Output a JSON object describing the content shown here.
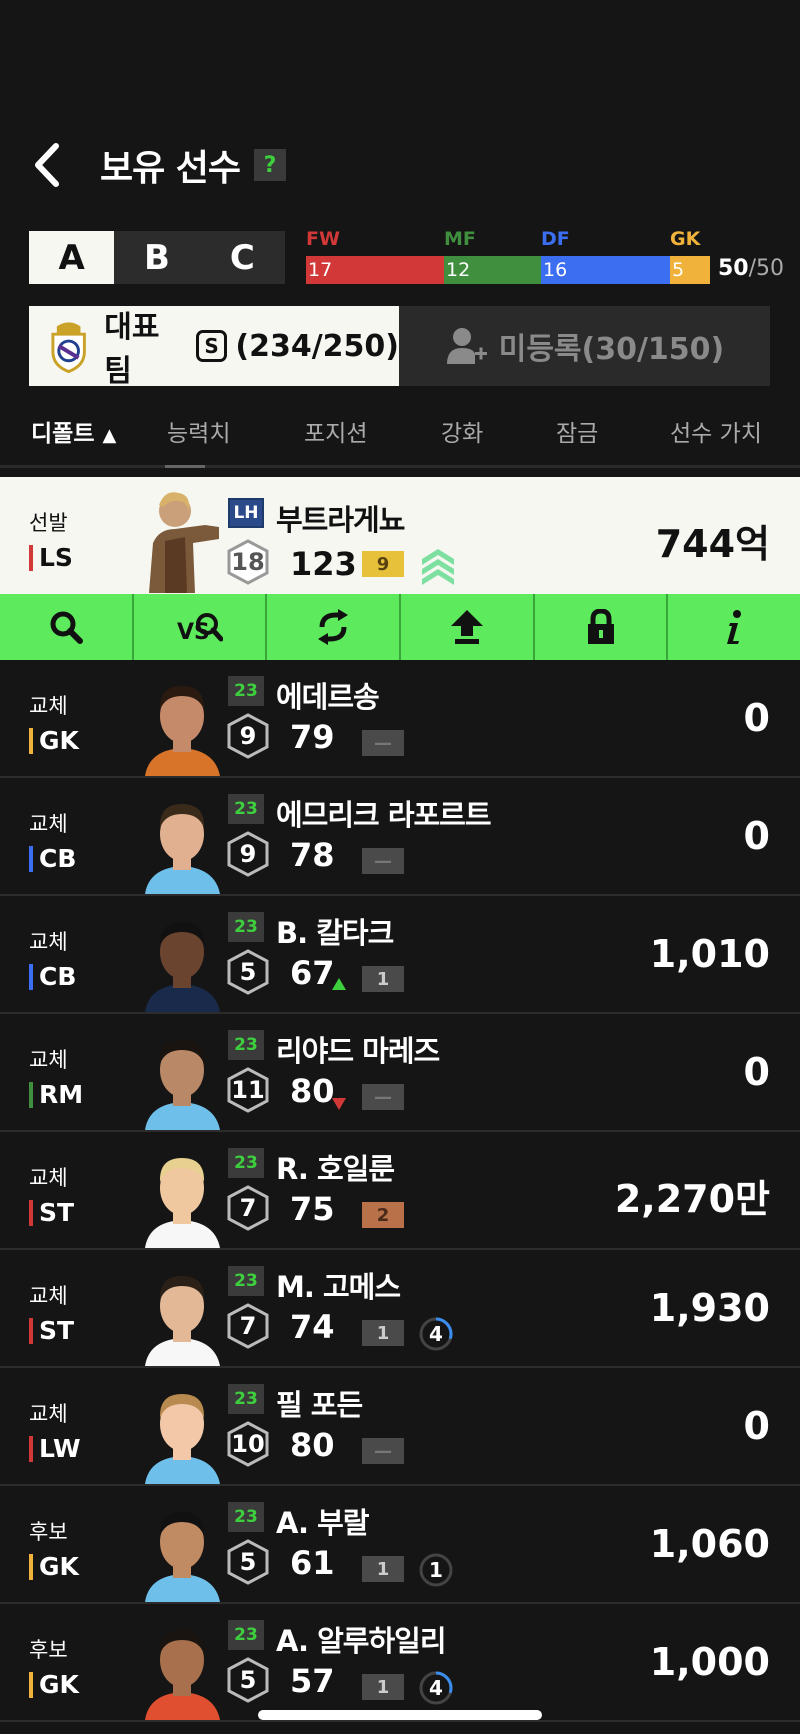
{
  "header": {
    "title": "보유 선수",
    "help": "?"
  },
  "squad_tabs": [
    "A",
    "B",
    "C"
  ],
  "position_bar": {
    "segments": [
      {
        "label": "FW",
        "count": "17",
        "color": "#d23838",
        "width": 138
      },
      {
        "label": "MF",
        "count": "12",
        "color": "#3f8f3f",
        "width": 97
      },
      {
        "label": "DF",
        "count": "16",
        "color": "#3b6ef0",
        "width": 129
      },
      {
        "label": "GK",
        "count": "5",
        "color": "#f0b23a",
        "width": 40
      }
    ],
    "total": "50",
    "total_max": "/50"
  },
  "team_tabs": {
    "main_label": "대표팀",
    "main_count": "(234/250)",
    "unregistered": "미등록(30/150)"
  },
  "sort_tabs": [
    "디폴트",
    "능력치",
    "포지션",
    "강화",
    "잠금",
    "선수 가치"
  ],
  "starter": {
    "status": "선발",
    "pos": "LS",
    "pos_color": "#d23838",
    "season": "LH",
    "name": "부트라게뇨",
    "level": "18",
    "ovr": "123",
    "grade": "9",
    "value": "744억"
  },
  "action_icons": [
    "search-icon",
    "vs-search-icon",
    "swap-icon",
    "upgrade-icon",
    "lock-icon",
    "info-icon"
  ],
  "players": [
    {
      "status": "교체",
      "pos": "GK",
      "pos_color": "#f0b23a",
      "season": "23",
      "name": "에데르송",
      "level": "9",
      "ovr": "79",
      "grade": "—",
      "value": "0"
    },
    {
      "status": "교체",
      "pos": "CB",
      "pos_color": "#3b6ef0",
      "season": "23",
      "name": "에므리크 라포르트",
      "level": "9",
      "ovr": "78",
      "grade": "—",
      "value": "0"
    },
    {
      "status": "교체",
      "pos": "CB",
      "pos_color": "#3b6ef0",
      "season": "23",
      "name": "B. 칼타크",
      "level": "5",
      "ovr": "67",
      "grade": "1",
      "value": "1,010",
      "trend": "up"
    },
    {
      "status": "교체",
      "pos": "RM",
      "pos_color": "#3f8f3f",
      "season": "23",
      "name": "리야드 마레즈",
      "level": "11",
      "ovr": "80",
      "grade": "—",
      "value": "0",
      "trend": "down"
    },
    {
      "status": "교체",
      "pos": "ST",
      "pos_color": "#d23838",
      "season": "23",
      "name": "R. 호일룬",
      "level": "7",
      "ovr": "75",
      "grade": "2",
      "value": "2,270만",
      "grade_color": "#b9714a"
    },
    {
      "status": "교체",
      "pos": "ST",
      "pos_color": "#d23838",
      "season": "23",
      "name": "M. 고메스",
      "level": "7",
      "ovr": "74",
      "grade": "1",
      "value": "1,930",
      "circle": "4"
    },
    {
      "status": "교체",
      "pos": "LW",
      "pos_color": "#d23838",
      "season": "23",
      "name": "필 포든",
      "level": "10",
      "ovr": "80",
      "grade": "—",
      "value": "0"
    },
    {
      "status": "후보",
      "pos": "GK",
      "pos_color": "#f0b23a",
      "season": "23",
      "name": "A. 부랄",
      "level": "5",
      "ovr": "61",
      "grade": "1",
      "value": "1,060",
      "circle": "1"
    },
    {
      "status": "후보",
      "pos": "GK",
      "pos_color": "#f0b23a",
      "season": "23",
      "name": "A. 알루하일리",
      "level": "5",
      "ovr": "57",
      "grade": "1",
      "value": "1,000",
      "circle": "4"
    }
  ]
}
